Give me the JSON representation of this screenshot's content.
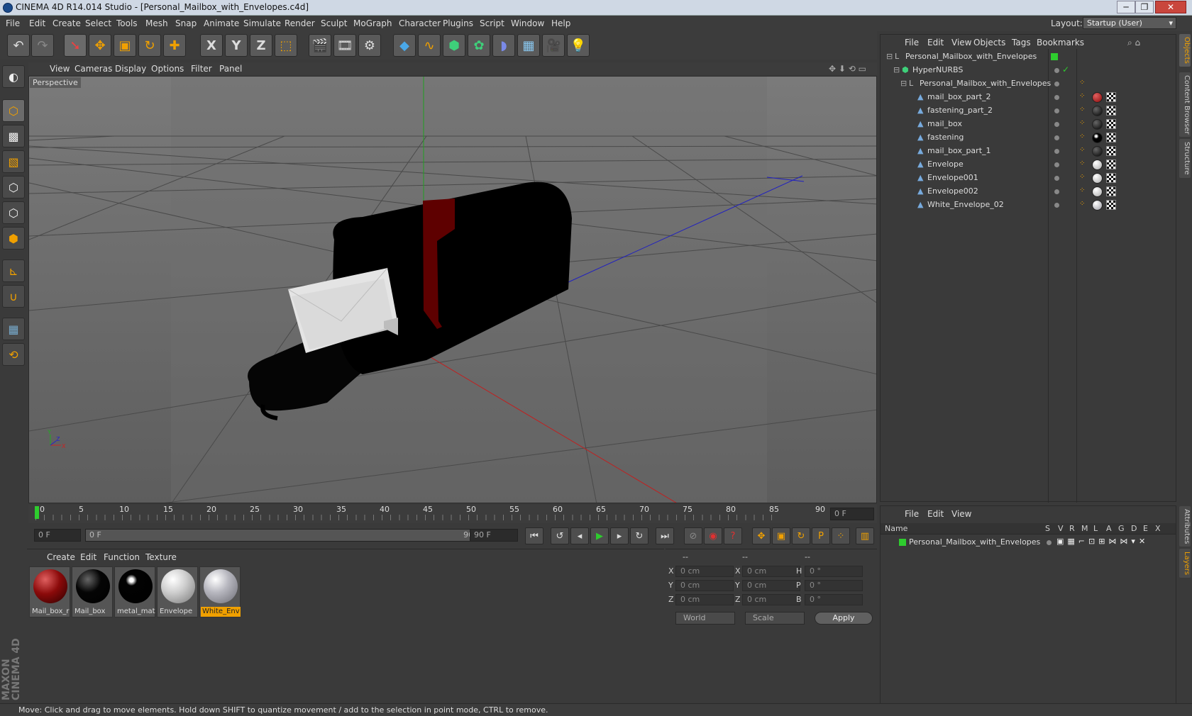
{
  "window": {
    "title": "CINEMA 4D R14.014 Studio - [Personal_Mailbox_with_Envelopes.c4d]",
    "min": "─",
    "max": "❐",
    "close": "✕"
  },
  "menu": [
    "File",
    "Edit",
    "Create",
    "Select",
    "Tools",
    "Mesh",
    "Snap",
    "Animate",
    "Simulate",
    "Render",
    "Sculpt",
    "MoGraph",
    "Character",
    "Plugins",
    "Script",
    "Window",
    "Help"
  ],
  "layout": {
    "label": "Layout:",
    "value": "Startup (User)"
  },
  "toolbar": {
    "icons": [
      "undo-icon",
      "redo-icon",
      "live-select-icon",
      "move-icon",
      "scale-icon",
      "rotate-icon",
      "create-icon",
      "x-axis-icon",
      "y-axis-icon",
      "z-axis-icon",
      "world-coords-icon",
      "render-view-icon",
      "render-picture-queue-icon",
      "render-settings-icon",
      "cube-icon",
      "spline-pen-icon",
      "subdivision-icon",
      "cloner-icon",
      "deformer-icon",
      "floor-icon",
      "camera-icon",
      "light-icon"
    ],
    "glyphs": {
      "undo": "↶",
      "redo": "↷",
      "select": "➘",
      "move": "✥",
      "scale": "▣",
      "rotate": "↻",
      "create": "✚",
      "x": "X",
      "y": "Y",
      "z": "Z",
      "world": "⬚"
    }
  },
  "viewport": {
    "menu": [
      "View",
      "Cameras",
      "Display",
      "Options",
      "Filter",
      "Panel"
    ],
    "label": "Perspective"
  },
  "timeline": {
    "ticks": [
      "0",
      "5",
      "10",
      "15",
      "20",
      "25",
      "30",
      "35",
      "40",
      "45",
      "50",
      "55",
      "60",
      "65",
      "70",
      "75",
      "80",
      "85",
      "90"
    ],
    "current": "0 F",
    "start": "0 F",
    "range_left": "0 F",
    "range_right": "90 F",
    "end": "90 F"
  },
  "materials": {
    "menu": [
      "Create",
      "Edit",
      "Function",
      "Texture"
    ],
    "items": [
      {
        "label": "Mail_box_r",
        "color": "#8b0a0a"
      },
      {
        "label": "Mail_box",
        "color": "#050505"
      },
      {
        "label": "metal_mate",
        "color": "#020202"
      },
      {
        "label": "Envelope",
        "color": "#cfcfcf"
      },
      {
        "label": "White_Env",
        "color": "#b8b8c0",
        "selected": true
      }
    ]
  },
  "coords": {
    "headers": [
      "--",
      "--",
      "--"
    ],
    "rows": [
      {
        "a": "X",
        "av": "0 cm",
        "b": "X",
        "bv": "0 cm",
        "c": "H",
        "cv": "0 °"
      },
      {
        "a": "Y",
        "av": "0 cm",
        "b": "Y",
        "bv": "0 cm",
        "c": "P",
        "cv": "0 °"
      },
      {
        "a": "Z",
        "av": "0 cm",
        "b": "Z",
        "bv": "0 cm",
        "c": "B",
        "cv": "0 °"
      }
    ],
    "mode": "World",
    "scale": "Scale",
    "apply": "Apply"
  },
  "objects": {
    "menu": [
      "File",
      "Edit",
      "View",
      "Objects",
      "Tags",
      "Bookmarks"
    ],
    "rows": [
      {
        "name": "Personal_Mailbox_with_Envelopes",
        "level": 0,
        "type": "null"
      },
      {
        "name": "HyperNURBS",
        "level": 1,
        "type": "nurbs"
      },
      {
        "name": "Personal_Mailbox_with_Envelopes",
        "level": 2,
        "type": "null"
      },
      {
        "name": "mail_box_part_2",
        "level": 3,
        "type": "poly",
        "mat": "#8b0a0a"
      },
      {
        "name": "fastening_part_2",
        "level": 3,
        "type": "poly",
        "mat": "#050505"
      },
      {
        "name": "mail_box",
        "level": 3,
        "type": "poly",
        "mat": "#050505"
      },
      {
        "name": "fastening",
        "level": 3,
        "type": "poly",
        "mat": "#020202"
      },
      {
        "name": "mail_box_part_1",
        "level": 3,
        "type": "poly",
        "mat": "#050505"
      },
      {
        "name": "Envelope",
        "level": 3,
        "type": "poly",
        "mat": "#d0d0d0"
      },
      {
        "name": "Envelope001",
        "level": 3,
        "type": "poly",
        "mat": "#d0d0d0"
      },
      {
        "name": "Envelope002",
        "level": 3,
        "type": "poly",
        "mat": "#d0d0d0"
      },
      {
        "name": "White_Envelope_02",
        "level": 3,
        "type": "poly",
        "mat": "#c0c0c8"
      }
    ]
  },
  "layers": {
    "menu": [
      "File",
      "Edit",
      "View"
    ],
    "columns": [
      "Name",
      "S",
      "V",
      "R",
      "M",
      "L",
      "A",
      "G",
      "D",
      "E",
      "X"
    ],
    "row": "Personal_Mailbox_with_Envelopes"
  },
  "sidetabs": [
    "Objects",
    "Content Browser",
    "Structure",
    "Attributes",
    "Layers"
  ],
  "status": "Move: Click and drag to move elements. Hold down SHIFT to quantize movement / add to the selection in point mode, CTRL to remove.",
  "logo": "MAXON CINEMA 4D",
  "colors": {
    "accent": "#f0a000",
    "green": "#2ecc2e",
    "bg": "#3a3a3a"
  }
}
